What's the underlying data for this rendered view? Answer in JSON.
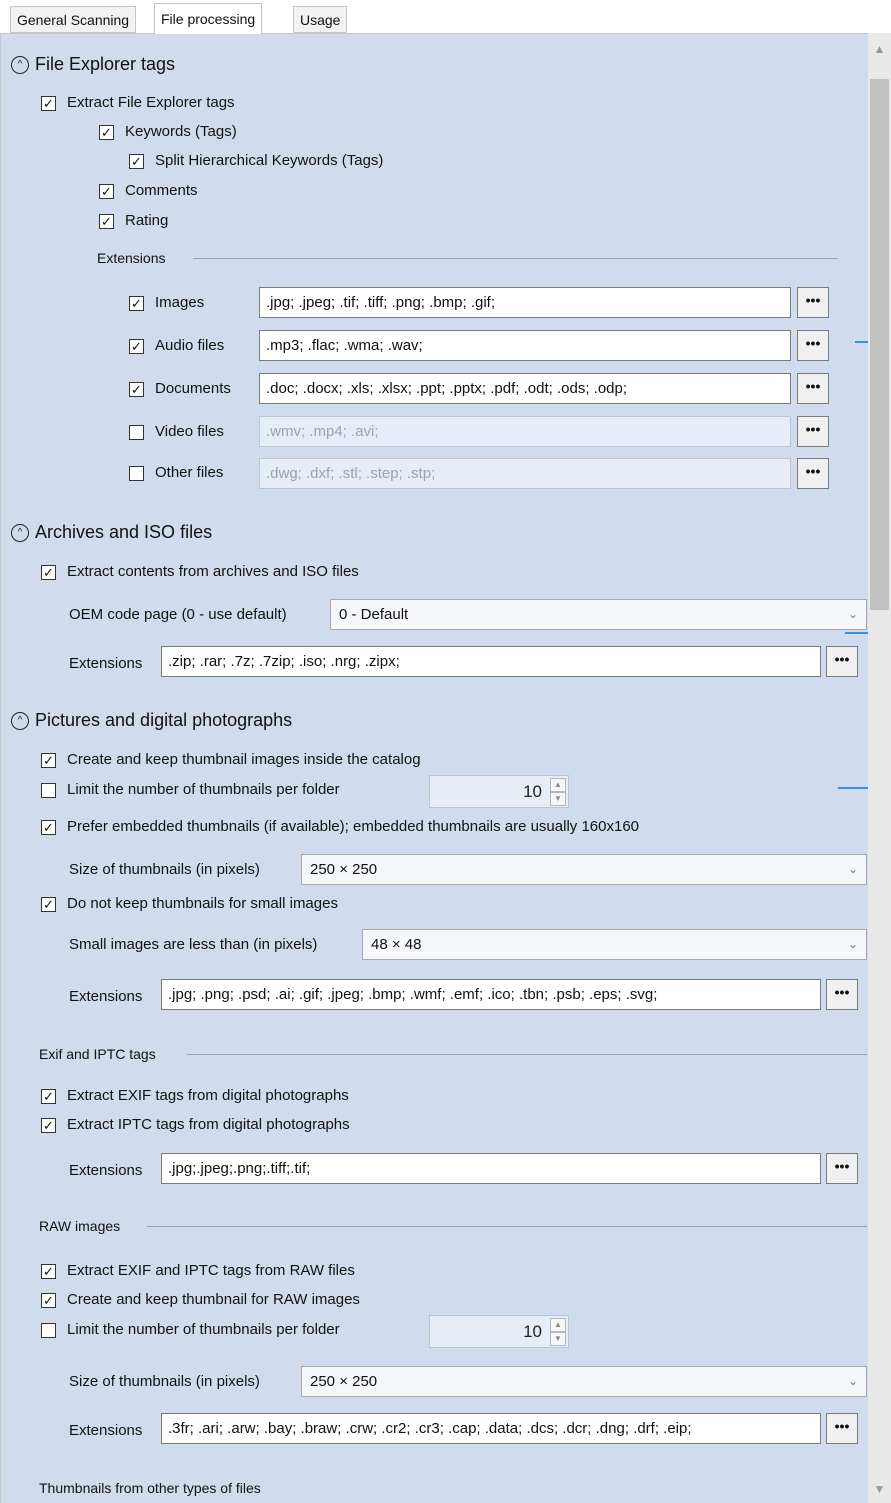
{
  "tabs": [
    "General Scanning",
    "File processing",
    "Usage"
  ],
  "explorer": {
    "title": "File Explorer tags",
    "extract": "Extract File Explorer tags",
    "keywords": "Keywords (Tags)",
    "split": "Split Hierarchical Keywords (Tags)",
    "comments": "Comments",
    "rating": "Rating",
    "extensions_label": "Extensions",
    "rows": [
      {
        "label": "Images",
        "value": ".jpg; .jpeg; .tif; .tiff; .png; .bmp; .gif;",
        "checked": true
      },
      {
        "label": "Audio files",
        "value": ".mp3; .flac; .wma; .wav;",
        "checked": true
      },
      {
        "label": "Documents",
        "value": ".doc; .docx; .xls; .xlsx; .ppt; .pptx; .pdf; .odt; .ods; .odp;",
        "checked": true
      },
      {
        "label": "Video files",
        "value": ".wmv; .mp4; .avi;",
        "checked": false
      },
      {
        "label": "Other files",
        "value": ".dwg; .dxf; .stl; .step; .stp;",
        "checked": false
      }
    ]
  },
  "archives": {
    "title": "Archives and ISO files",
    "extract": "Extract contents from archives and ISO files",
    "oem_label": "OEM code page (0 - use default)",
    "oem_value": "0 - Default",
    "extensions_label": "Extensions",
    "extensions": ".zip; .rar; .7z; .7zip; .iso; .nrg; .zipx;"
  },
  "pictures": {
    "title": "Pictures and digital photographs",
    "create_thumbs": "Create and keep thumbnail images inside the catalog",
    "limit_thumbs": "Limit the number of thumbnails per folder",
    "limit_value": "10",
    "prefer_embedded": "Prefer embedded thumbnails (if available); embedded thumbnails are usually 160x160",
    "size_label": "Size of thumbnails (in pixels)",
    "size_value": "250 × 250",
    "no_small": "Do not keep thumbnails for small images",
    "small_label": "Small images are less than (in pixels)",
    "small_value": "48 × 48",
    "extensions_label": "Extensions",
    "extensions": ".jpg; .png; .psd; .ai; .gif; .jpeg; .bmp; .wmf; .emf; .ico; .tbn; .psb; .eps; .svg;"
  },
  "exif": {
    "title": "Exif and IPTC tags",
    "extract_exif": "Extract EXIF tags from digital photographs",
    "extract_iptc": "Extract IPTC tags from digital photographs",
    "extensions_label": "Extensions",
    "extensions": ".jpg;.jpeg;.png;.tiff;.tif;"
  },
  "raw": {
    "title": "RAW images",
    "extract": "Extract EXIF and IPTC tags from RAW files",
    "create_thumb": "Create and keep thumbnail for RAW images",
    "limit_thumbs": "Limit the number of thumbnails per folder",
    "limit_value": "10",
    "size_label": "Size of thumbnails (in pixels)",
    "size_value": "250 × 250",
    "extensions_label": "Extensions",
    "extensions": ".3fr; .ari; .arw; .bay; .braw; .crw; .cr2; .cr3; .cap; .data; .dcs; .dcr; .dng; .drf; .eip;"
  },
  "other_thumbs_title": "Thumbnails from other types of files",
  "browse_label": "•••",
  "check_mark": "✓",
  "collapse_glyph": "^",
  "chevron_glyph": "⌄"
}
